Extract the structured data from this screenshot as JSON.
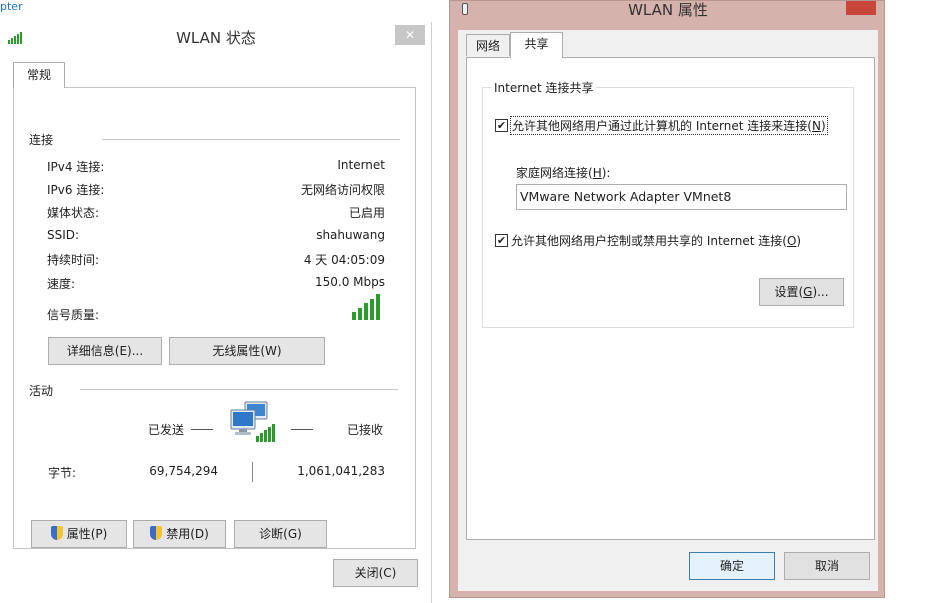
{
  "fragment": "pter",
  "status_dialog": {
    "title": "WLAN 状态",
    "close_glyph": "✕",
    "tab": "常规",
    "connection_section": "连接",
    "rows": [
      {
        "label": "IPv4 连接:",
        "value": "Internet"
      },
      {
        "label": "IPv6 连接:",
        "value": "无网络访问权限"
      },
      {
        "label": "媒体状态:",
        "value": "已启用"
      },
      {
        "label": "SSID:",
        "value": "shahuwang"
      },
      {
        "label": "持续时间:",
        "value": "4 天 04:05:09"
      },
      {
        "label": "速度:",
        "value": "150.0 Mbps"
      }
    ],
    "signal_label": "信号质量:",
    "details_button": "详细信息(E)...",
    "wireless_props_button": "无线属性(W)",
    "activity_section": "活动",
    "sent_label": "已发送",
    "received_label": "已接收",
    "bytes_label": "字节:",
    "bytes_sent": "69,754,294",
    "bytes_received": "1,061,041,283",
    "properties_button": "属性(P)",
    "disable_button": "禁用(D)",
    "diagnose_button": "诊断(G)",
    "close_button": "关闭(C)"
  },
  "properties_dialog": {
    "title": "WLAN 属性",
    "tabs": [
      "网络",
      "共享"
    ],
    "group_title": "Internet 连接共享",
    "allow_share_prefix": "允许其他网络用户通过此计算机的 Internet 连接来连接(",
    "allow_share_key": "N",
    "allow_share_suffix": ")",
    "allow_share_checked": true,
    "home_network_prefix": "家庭网络连接(",
    "home_network_key": "H",
    "home_network_suffix": "):",
    "home_network_value": "VMware Network Adapter VMnet8",
    "allow_control_prefix": "允许其他网络用户控制或禁用共享的 Internet 连接(",
    "allow_control_key": "O",
    "allow_control_suffix": ")",
    "allow_control_checked": true,
    "settings_prefix": "设置(",
    "settings_key": "G",
    "settings_suffix": ")...",
    "ok_button": "确定",
    "cancel_button": "取消"
  },
  "icons": {
    "signal": "wifi-signal-icon",
    "network_computers": "network-computers-icon",
    "shield": "uac-shield-icon",
    "check": "✔"
  },
  "colors": {
    "accent_link": "#1a6fc2",
    "title_bar_right": "#d6b2ac",
    "close_red": "#c9463d",
    "signal_green": "#2d9a2d"
  }
}
